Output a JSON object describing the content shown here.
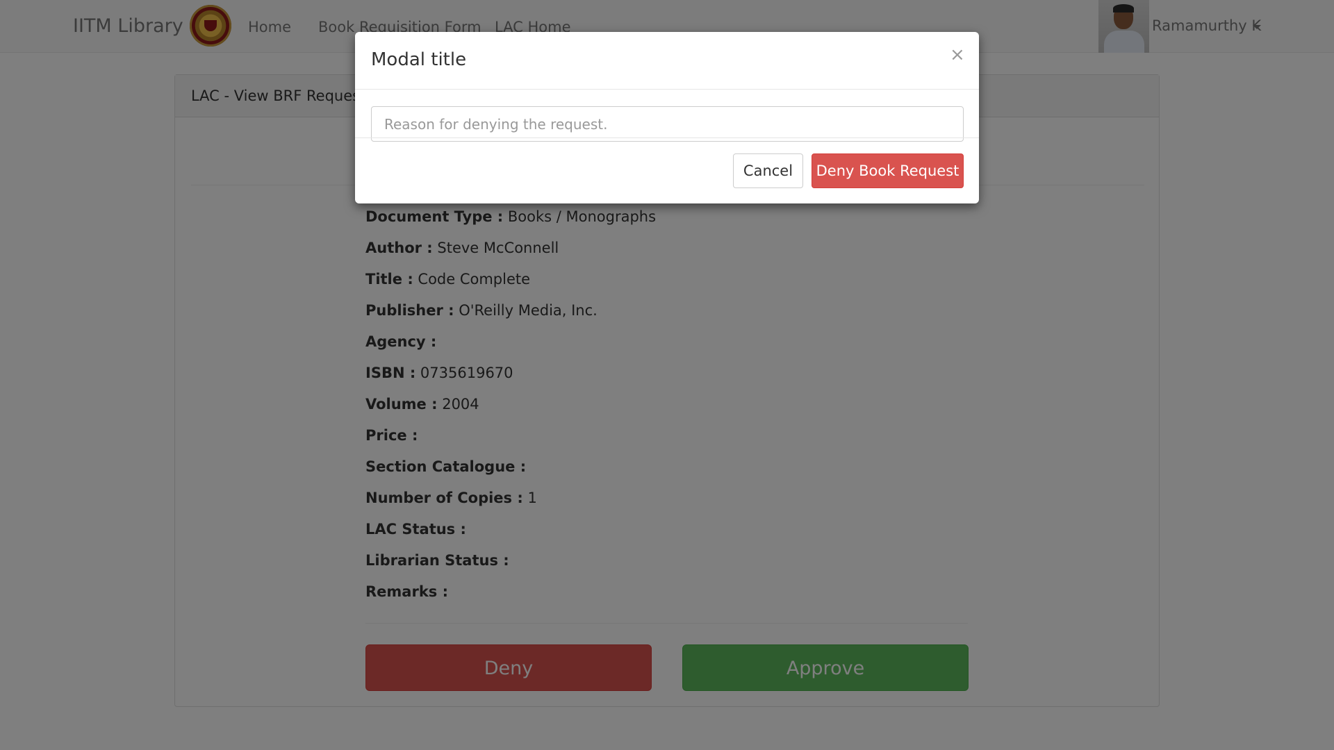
{
  "navbar": {
    "brand": "IITM Library",
    "links": [
      "Home",
      "Book Requisition Form",
      "LAC Home"
    ],
    "user_name": "Ramamurthy K"
  },
  "panel": {
    "title": "LAC - View BRF Request",
    "details": [
      {
        "label": "Document Type :",
        "value": "Books / Monographs"
      },
      {
        "label": "Author :",
        "value": "Steve McConnell"
      },
      {
        "label": "Title :",
        "value": "Code Complete"
      },
      {
        "label": "Publisher :",
        "value": "O'Reilly Media, Inc."
      },
      {
        "label": "Agency :",
        "value": ""
      },
      {
        "label": "ISBN :",
        "value": "0735619670"
      },
      {
        "label": "Volume :",
        "value": "2004"
      },
      {
        "label": "Price :",
        "value": ""
      },
      {
        "label": "Section Catalogue :",
        "value": ""
      },
      {
        "label": "Number of Copies :",
        "value": "1"
      },
      {
        "label": "LAC Status :",
        "value": ""
      },
      {
        "label": "Librarian Status :",
        "value": ""
      },
      {
        "label": "Remarks :",
        "value": ""
      }
    ],
    "deny_label": "Deny",
    "approve_label": "Approve"
  },
  "modal": {
    "title": "Modal title",
    "close_symbol": "×",
    "reason_placeholder": "Reason for denying the request.",
    "reason_value": "",
    "cancel_label": "Cancel",
    "deny_request_label": "Deny Book Request"
  },
  "colors": {
    "danger": "#d9534f",
    "success": "#5cb85c",
    "backdrop": "rgba(0,0,0,0.5)"
  },
  "icons": {
    "logo": "iitm-seal-icon",
    "user_menu_caret": "caret-down-icon",
    "modal_close": "close-icon"
  }
}
